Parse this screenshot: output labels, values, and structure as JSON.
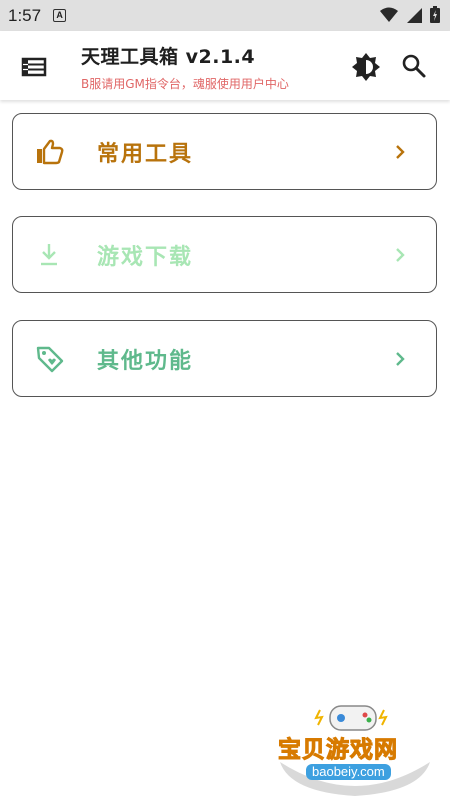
{
  "status_bar": {
    "time": "1:57",
    "notification_icon": "a-box-icon",
    "wifi_icon": "wifi-icon",
    "signal_icon": "cell-signal-icon",
    "battery_icon": "battery-icon"
  },
  "app_bar": {
    "title": "天理工具箱 v2.1.4",
    "subtitle": "B服请用GM指令台，魂服使用用户中心",
    "subtitle_color": "#e06666"
  },
  "menu": [
    {
      "label": "常用工具",
      "icon": "thumbs-up-icon",
      "color": "#b8730c"
    },
    {
      "label": "游戏下载",
      "icon": "download-icon",
      "color": "#a8e6b4"
    },
    {
      "label": "其他功能",
      "icon": "tag-icon",
      "color": "#5fb98c"
    }
  ],
  "watermark": {
    "text": "宝贝游戏网",
    "url": "baobeiy.com"
  }
}
